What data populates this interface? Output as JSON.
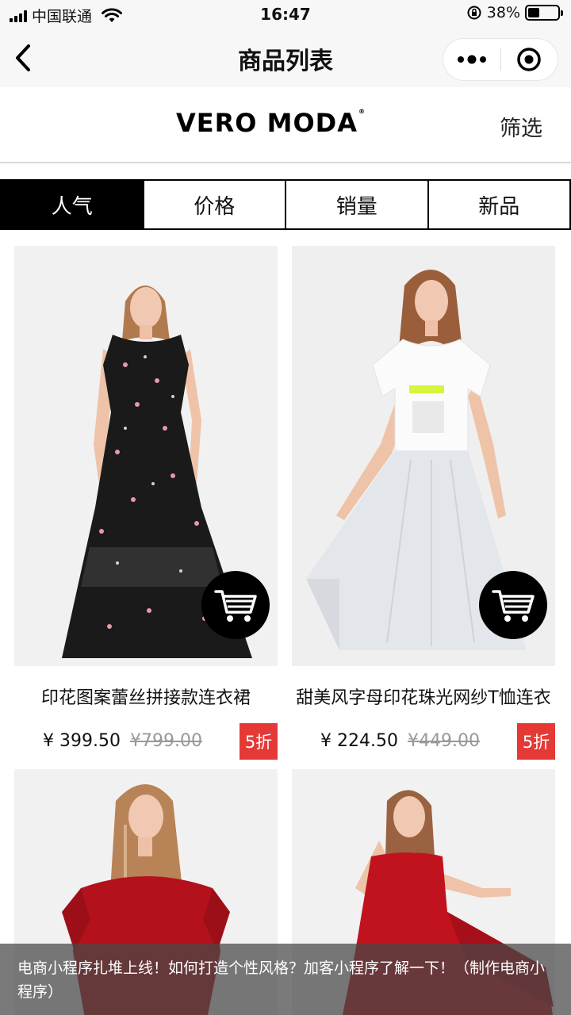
{
  "status_bar": {
    "carrier": "中国联通",
    "time": "16:47",
    "battery_percent": "38%",
    "battery_level": 0.38,
    "icons": [
      "signal-icon",
      "wifi-icon",
      "rotation-lock-icon",
      "battery-icon"
    ]
  },
  "nav": {
    "title": "商品列表",
    "back_icon": "chevron-left-icon",
    "more_icon": "more-dots-icon",
    "close_icon": "target-close-icon"
  },
  "brand": {
    "logo_text": "VERO MODA",
    "logo_mark": "®",
    "filter_label": "筛选"
  },
  "sort_tabs": [
    {
      "label": "人气",
      "active": true
    },
    {
      "label": "价格",
      "active": false
    },
    {
      "label": "销量",
      "active": false
    },
    {
      "label": "新品",
      "active": false
    }
  ],
  "products": [
    {
      "name": "印花图案蕾丝拼接款连衣裙",
      "price": "¥ 399.50",
      "original_price": "¥799.00",
      "discount": "5折",
      "cart_icon": "shopping-cart-icon"
    },
    {
      "name": "甜美风字母印花珠光网纱T恤连衣",
      "price": "¥ 224.50",
      "original_price": "¥449.00",
      "discount": "5折",
      "cart_icon": "shopping-cart-icon"
    },
    {
      "name": "",
      "price": "",
      "original_price": "",
      "discount": ""
    },
    {
      "name": "",
      "price": "",
      "original_price": "",
      "discount": ""
    }
  ],
  "caption": "电商小程序扎堆上线！如何打造个性风格？加客小程序了解一下！（制作电商小程序）",
  "colors": {
    "active_tab_bg": "#000000",
    "discount_badge": "#e53935",
    "caption_overlay": "rgba(70,70,70,0.72)"
  }
}
